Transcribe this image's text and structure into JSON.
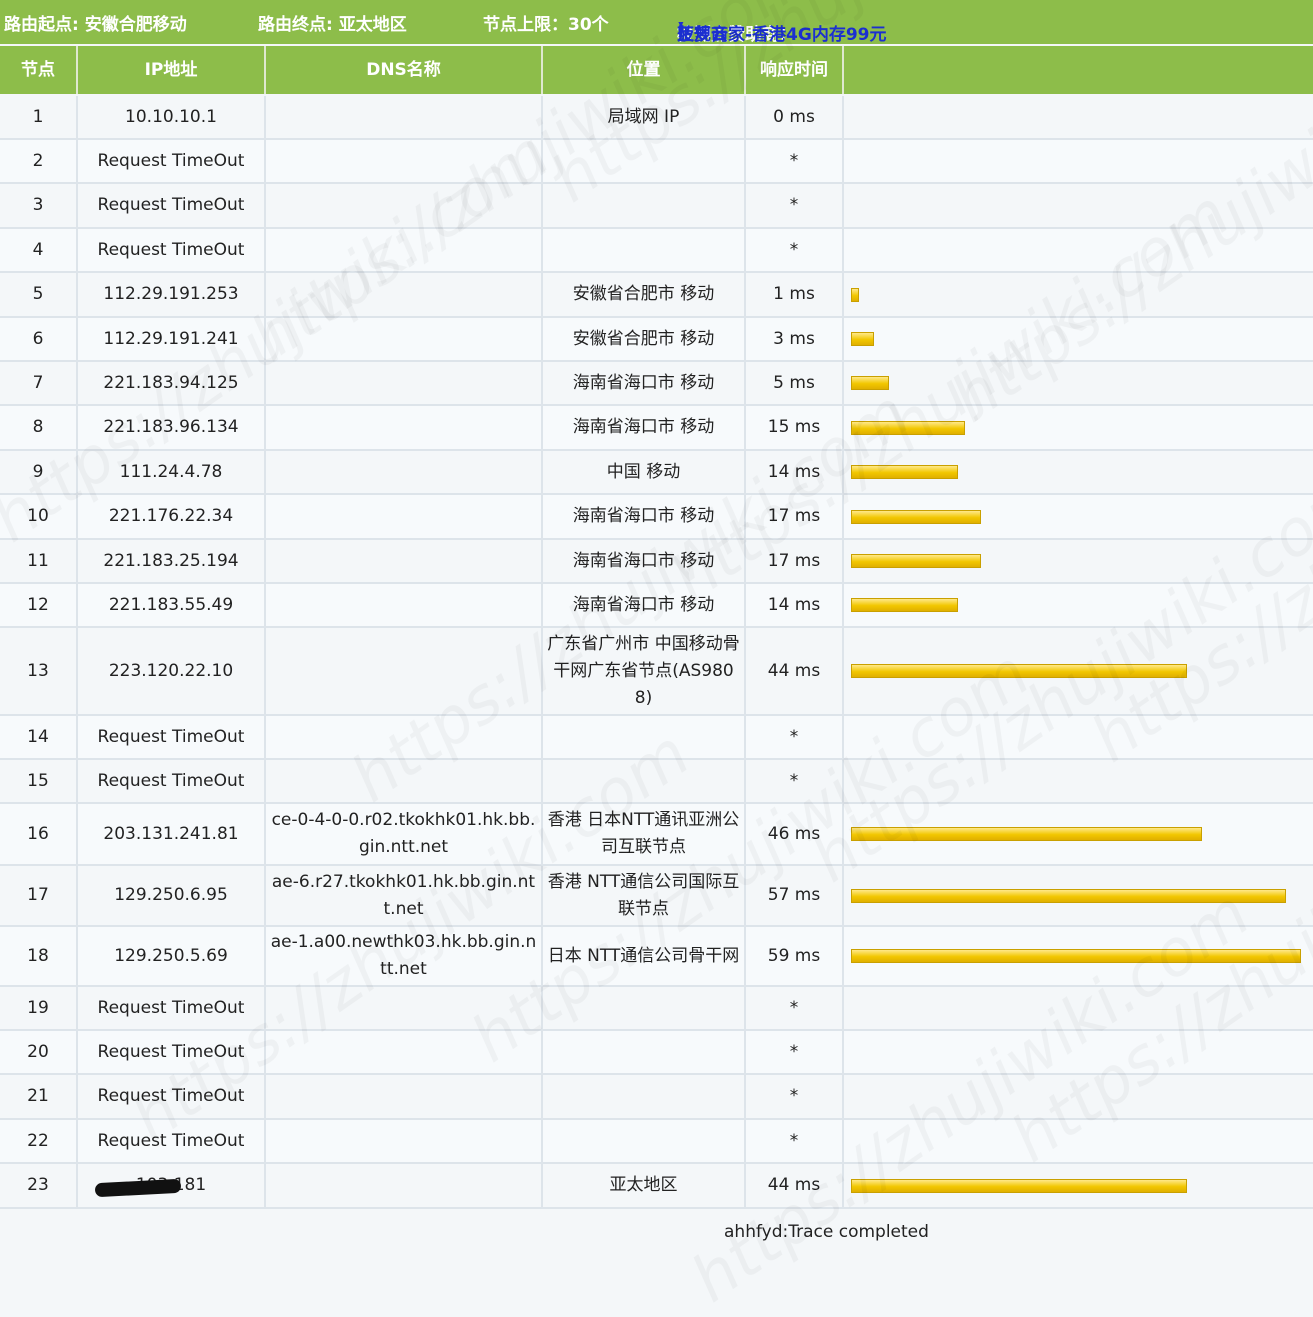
{
  "topbar": {
    "origin": "路由起点: 安徽合肥移动",
    "destination": "路由终点: 亚太地区",
    "hop_limit": "节点上限：30个",
    "sponsor_label": "检测点赞助商：",
    "sponsor_name": "菠萝云",
    "sponsor_link": "正规商家-香港4G内存99元",
    "paren_open": "(",
    "paren_close": ")"
  },
  "columns": [
    "节点",
    "IP地址",
    "DNS名称",
    "位置",
    "响应时间",
    ""
  ],
  "rows": [
    {
      "hop": "1",
      "ip": "10.10.10.1",
      "dns": "",
      "loc": "局域网 IP",
      "time": "0 ms",
      "ms": 0
    },
    {
      "hop": "2",
      "ip": "Request TimeOut",
      "dns": "",
      "loc": "",
      "time": "*",
      "ms": null
    },
    {
      "hop": "3",
      "ip": "Request TimeOut",
      "dns": "",
      "loc": "",
      "time": "*",
      "ms": null
    },
    {
      "hop": "4",
      "ip": "Request TimeOut",
      "dns": "",
      "loc": "",
      "time": "*",
      "ms": null
    },
    {
      "hop": "5",
      "ip": "112.29.191.253",
      "dns": "",
      "loc": "安徽省合肥市 移动",
      "time": "1 ms",
      "ms": 1
    },
    {
      "hop": "6",
      "ip": "112.29.191.241",
      "dns": "",
      "loc": "安徽省合肥市 移动",
      "time": "3 ms",
      "ms": 3
    },
    {
      "hop": "7",
      "ip": "221.183.94.125",
      "dns": "",
      "loc": "海南省海口市 移动",
      "time": "5 ms",
      "ms": 5
    },
    {
      "hop": "8",
      "ip": "221.183.96.134",
      "dns": "",
      "loc": "海南省海口市 移动",
      "time": "15 ms",
      "ms": 15
    },
    {
      "hop": "9",
      "ip": "111.24.4.78",
      "dns": "",
      "loc": "中国 移动",
      "time": "14 ms",
      "ms": 14
    },
    {
      "hop": "10",
      "ip": "221.176.22.34",
      "dns": "",
      "loc": "海南省海口市 移动",
      "time": "17 ms",
      "ms": 17
    },
    {
      "hop": "11",
      "ip": "221.183.25.194",
      "dns": "",
      "loc": "海南省海口市 移动",
      "time": "17 ms",
      "ms": 17
    },
    {
      "hop": "12",
      "ip": "221.183.55.49",
      "dns": "",
      "loc": "海南省海口市 移动",
      "time": "14 ms",
      "ms": 14
    },
    {
      "hop": "13",
      "ip": "223.120.22.10",
      "dns": "",
      "loc": "广东省广州市 中国移动骨干网广东省节点(AS9808)",
      "time": "44 ms",
      "ms": 44
    },
    {
      "hop": "14",
      "ip": "Request TimeOut",
      "dns": "",
      "loc": "",
      "time": "*",
      "ms": null
    },
    {
      "hop": "15",
      "ip": "Request TimeOut",
      "dns": "",
      "loc": "",
      "time": "*",
      "ms": null
    },
    {
      "hop": "16",
      "ip": "203.131.241.81",
      "dns": "ce-0-4-0-0.r02.tkokhk01.hk.bb.gin.ntt.net",
      "loc": "香港 日本NTT通讯亚洲公司互联节点",
      "time": "46 ms",
      "ms": 46
    },
    {
      "hop": "17",
      "ip": "129.250.6.95",
      "dns": "ae-6.r27.tkokhk01.hk.bb.gin.ntt.net",
      "loc": "香港 NTT通信公司国际互联节点",
      "time": "57 ms",
      "ms": 57
    },
    {
      "hop": "18",
      "ip": "129.250.5.69",
      "dns": "ae-1.a00.newthk03.hk.bb.gin.ntt.net",
      "loc": "日本 NTT通信公司骨干网",
      "time": "59 ms",
      "ms": 59
    },
    {
      "hop": "19",
      "ip": "Request TimeOut",
      "dns": "",
      "loc": "",
      "time": "*",
      "ms": null
    },
    {
      "hop": "20",
      "ip": "Request TimeOut",
      "dns": "",
      "loc": "",
      "time": "*",
      "ms": null
    },
    {
      "hop": "21",
      "ip": "Request TimeOut",
      "dns": "",
      "loc": "",
      "time": "*",
      "ms": null
    },
    {
      "hop": "22",
      "ip": "Request TimeOut",
      "dns": "",
      "loc": "",
      "time": "*",
      "ms": null
    },
    {
      "hop": "23",
      "ip": "103.181",
      "dns": "",
      "loc": "亚太地区",
      "time": "44 ms",
      "ms": 44,
      "redacted": true
    }
  ],
  "footer": "ahhfyd:Trace completed",
  "watermark": "https://zhujiwiki.com",
  "colors": {
    "header_bg": "#8dbd4a",
    "bar": "#f2c700",
    "sponsor_link": "#1b2fd0"
  }
}
